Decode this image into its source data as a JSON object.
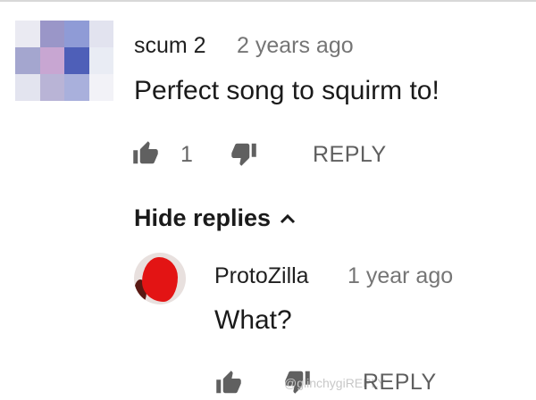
{
  "comment": {
    "author": "scum 2",
    "time": "2 years ago",
    "text": "Perfect song to squirm to!",
    "likes": "1",
    "reply_label": "REPLY"
  },
  "replies_toggle": {
    "label": "Hide replies",
    "icon": "chevron-up-icon"
  },
  "reply": {
    "author": "ProtoZilla",
    "time": "1 year ago",
    "text": "What?",
    "reply_label": "REPLY"
  },
  "watermark": "@glinchygiREPLY",
  "colors": {
    "text": "#1a1a1a",
    "muted": "#757575",
    "icon": "#5f5f5f",
    "avatar_red": "#e31414"
  }
}
